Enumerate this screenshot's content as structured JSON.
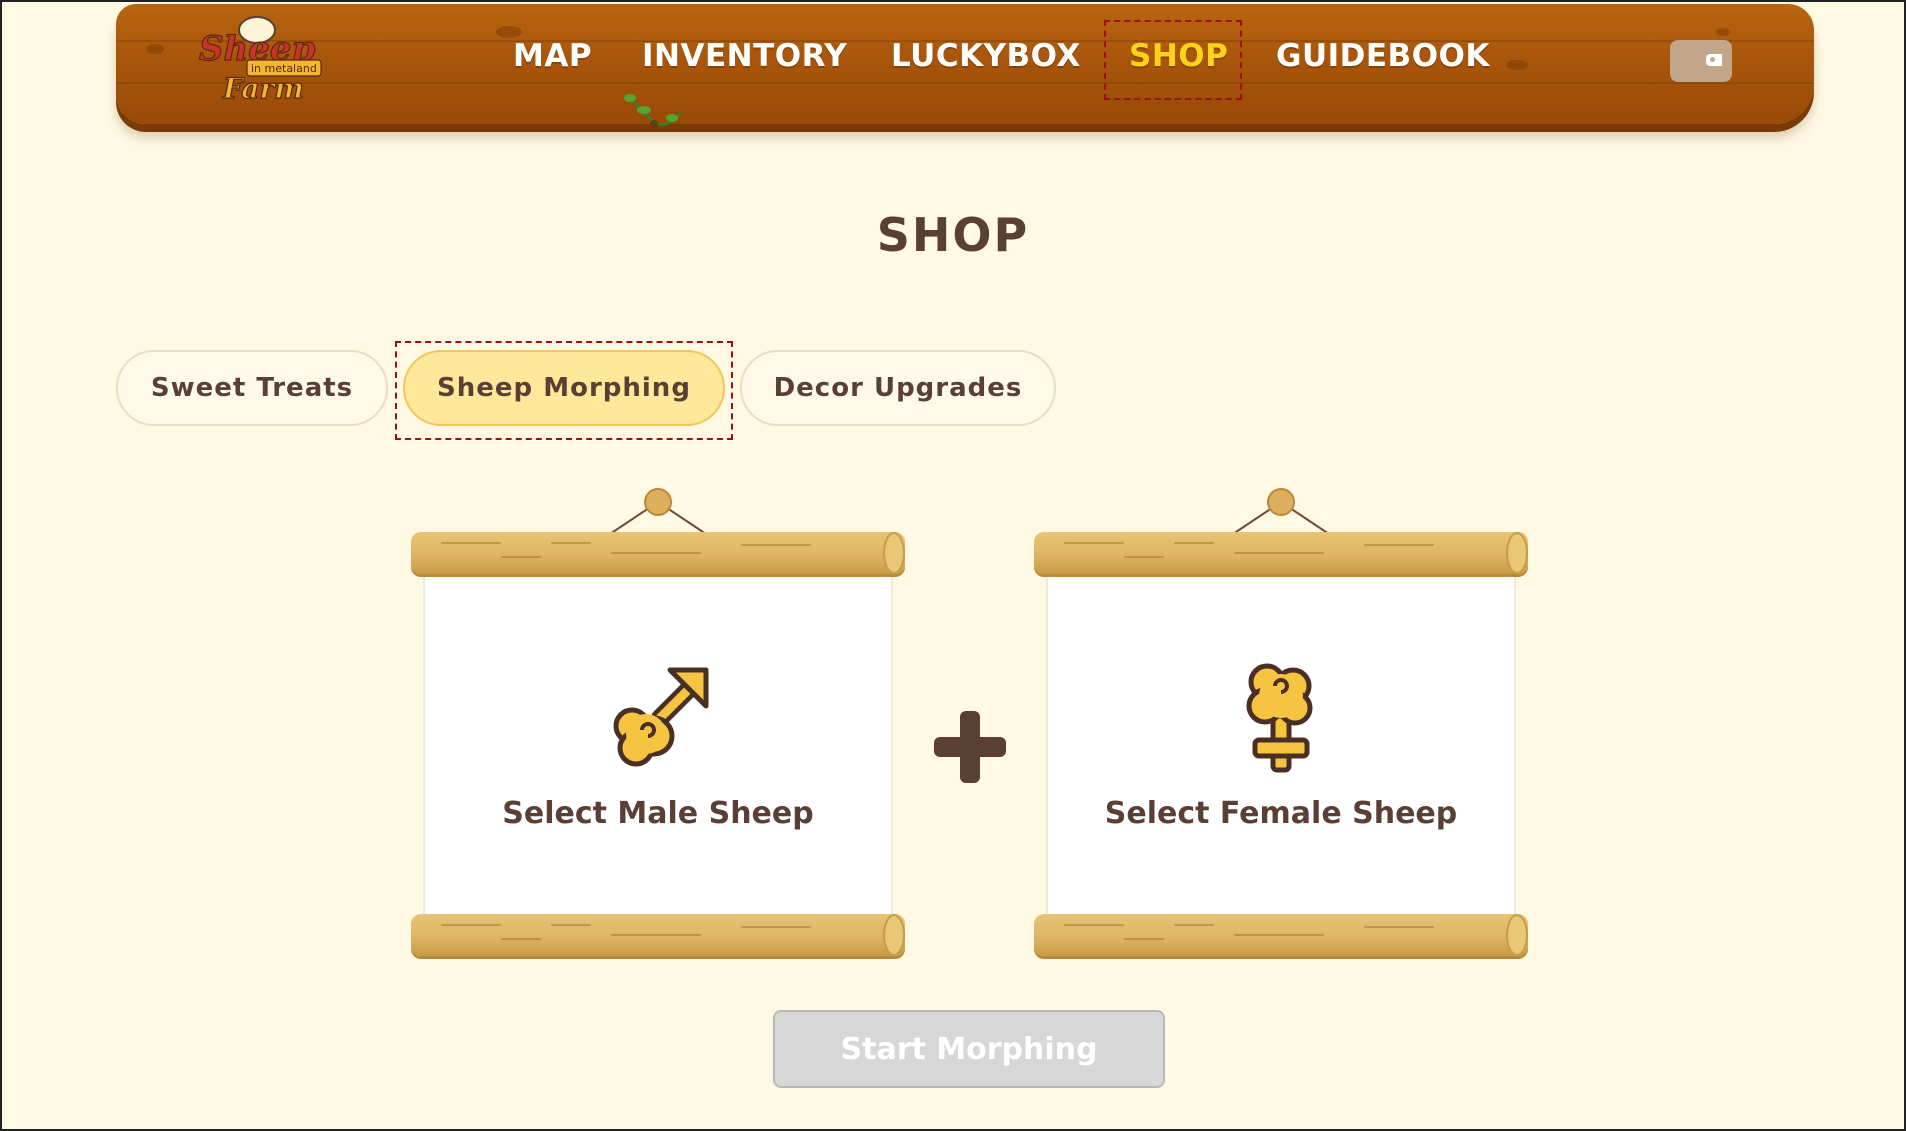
{
  "nav": {
    "links": [
      "MAP",
      "INVENTORY",
      "LUCKYBOX",
      "SHOP",
      "GUIDEBOOK"
    ],
    "active": "SHOP",
    "logo_lines": [
      "Sheep",
      "in metaland",
      "Farm"
    ]
  },
  "page": {
    "title": "SHOP"
  },
  "tabs": {
    "items": [
      "Sweet Treats",
      "Sheep Morphing",
      "Decor Upgrades"
    ],
    "active": "Sheep Morphing"
  },
  "morphing": {
    "male_label": "Select Male Sheep",
    "female_label": "Select Female Sheep",
    "start_label": "Start Morphing"
  },
  "colors": {
    "background": "#fff8e3",
    "plank": "#a9560b",
    "active_nav": "#ffd21a",
    "active_tab": "#ffe89a",
    "text_dark": "#5a3f35",
    "sheep_yellow": "#f5c542",
    "disabled_button": "#d7d7d7"
  },
  "icons": {
    "wallet": "wallet-icon",
    "male": "male-sheep-icon",
    "female": "female-sheep-icon",
    "plus": "plus-icon"
  }
}
